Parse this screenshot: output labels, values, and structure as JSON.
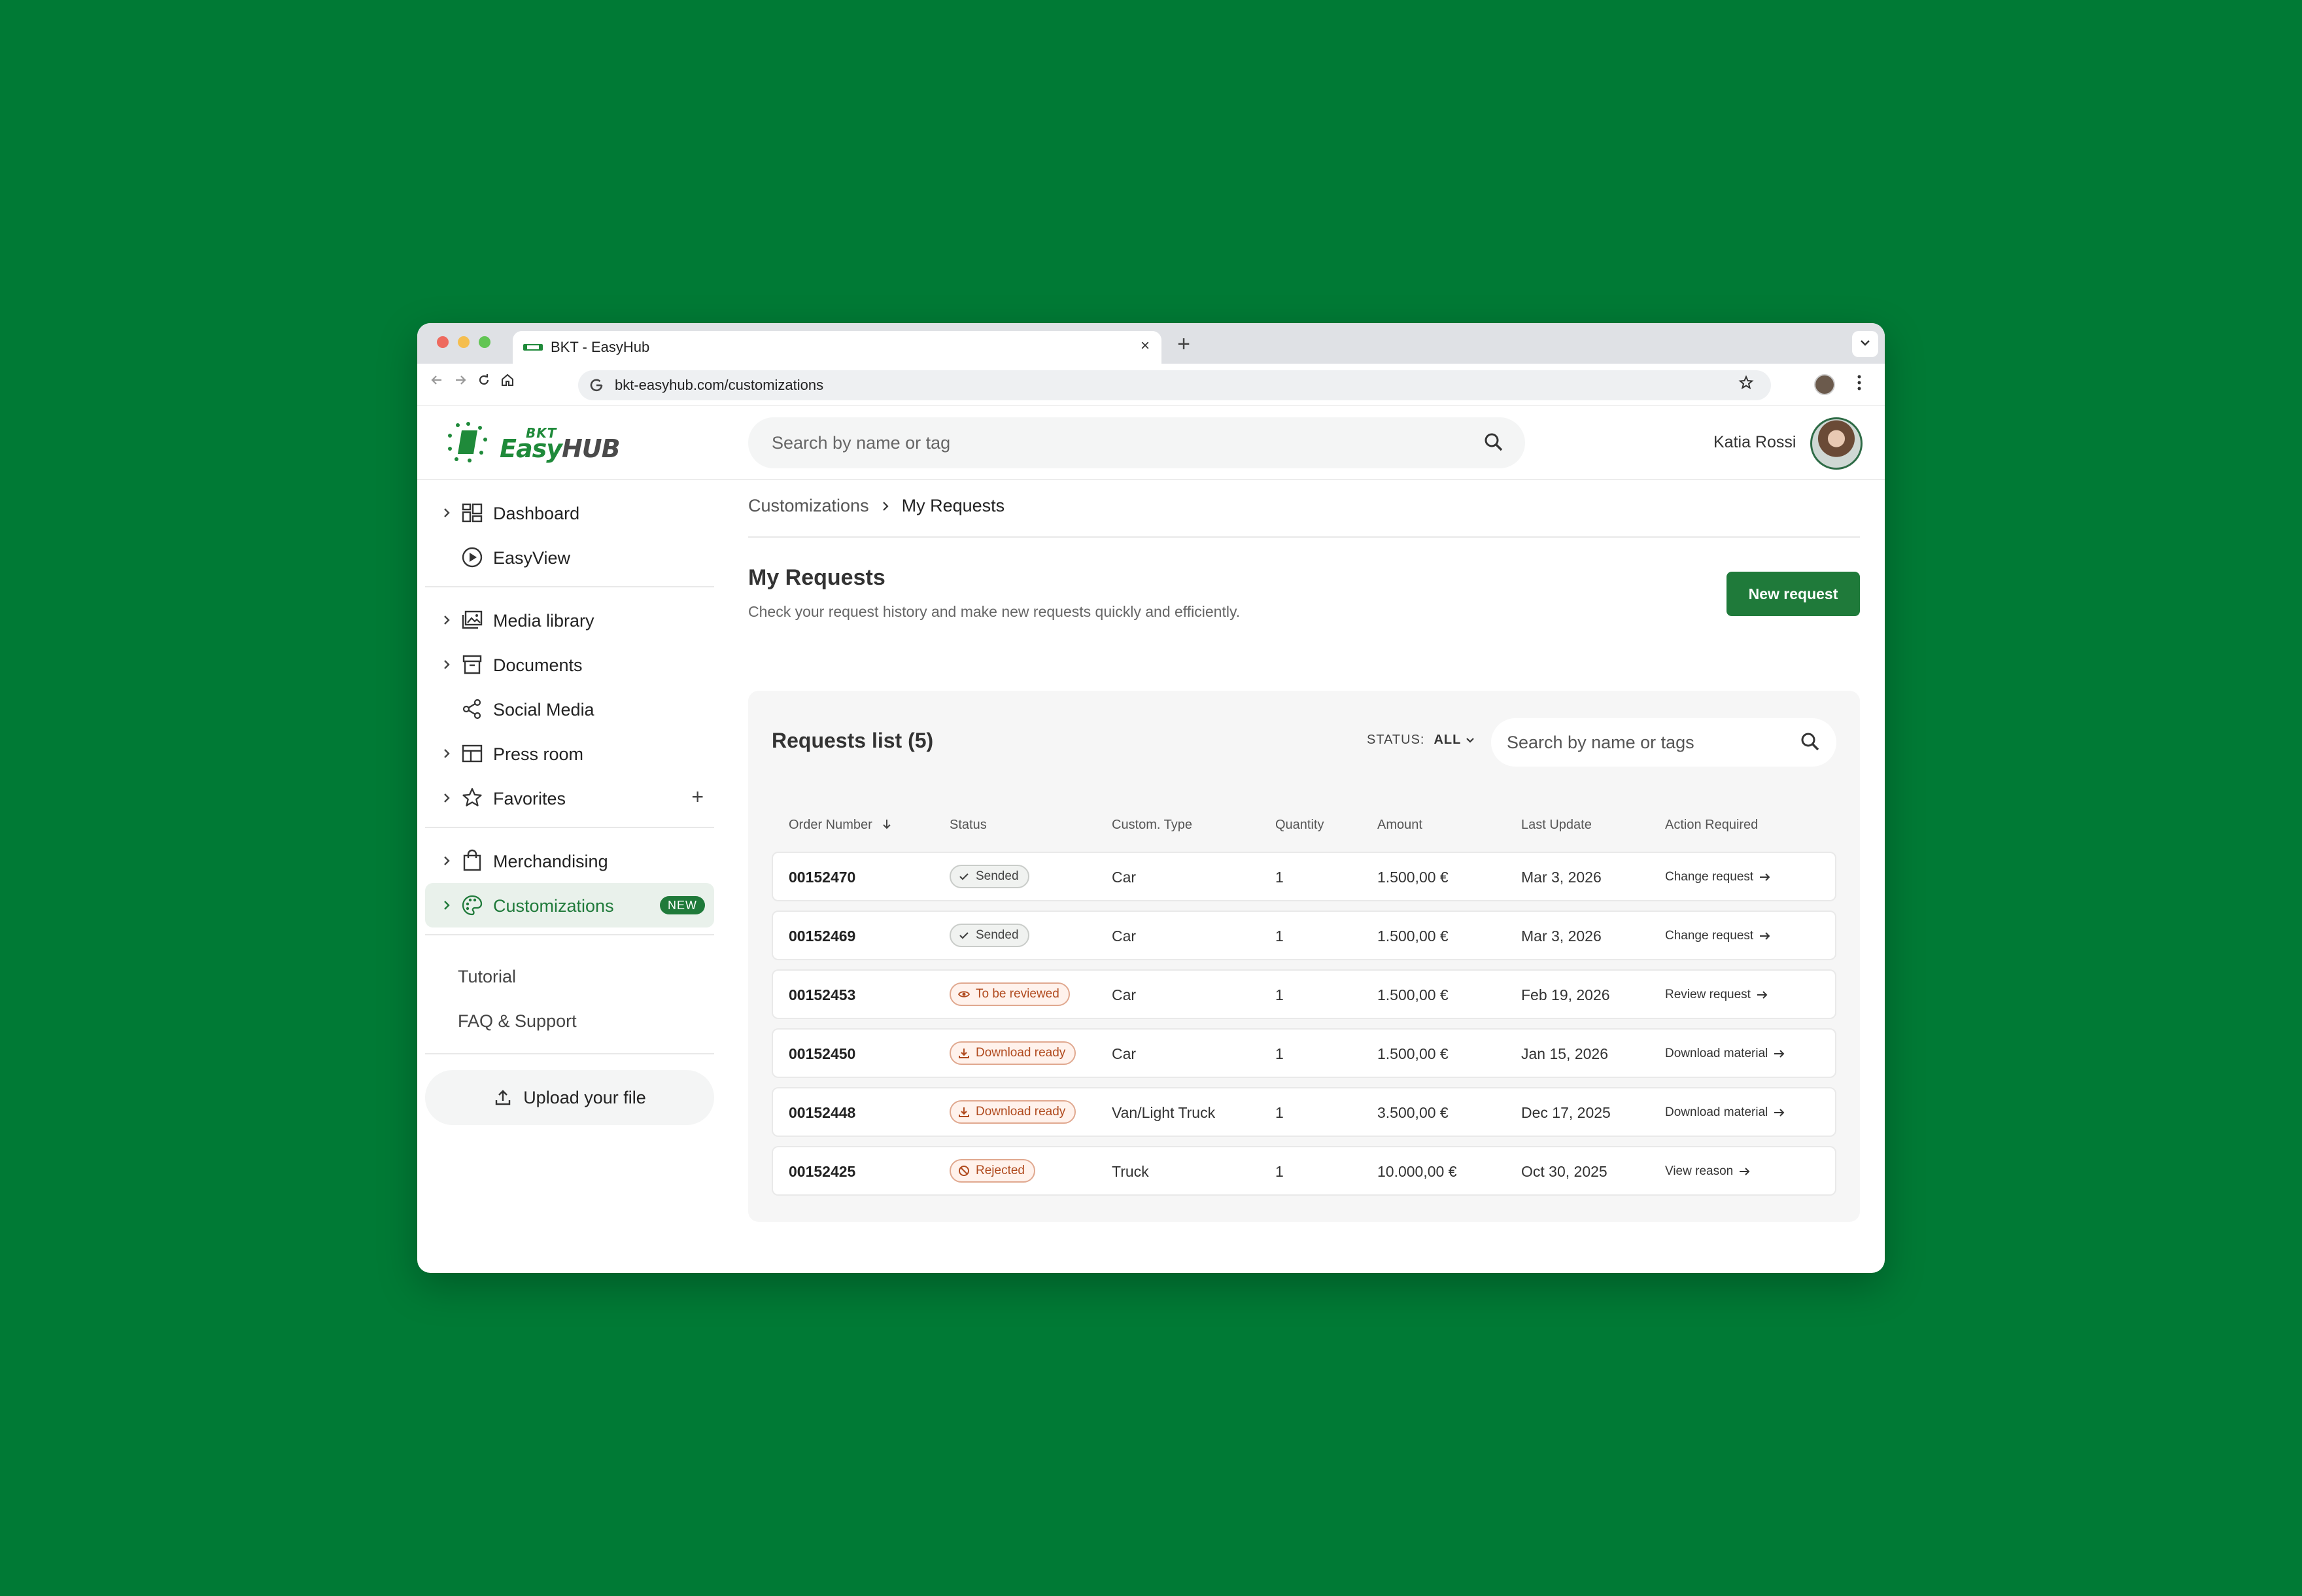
{
  "browser": {
    "tab_title": "BKT - EasyHub",
    "url": "bkt-easyhub.com/customizations"
  },
  "header": {
    "logo_top": "BKT",
    "logo_main_a": "Easy",
    "logo_main_b": "HUB",
    "search_placeholder": "Search by name or tag",
    "user_name": "Katia Rossi"
  },
  "sidebar": {
    "items": [
      {
        "label": "Dashboard",
        "icon": "dashboard-icon"
      },
      {
        "label": "EasyView",
        "icon": "play-circle-icon"
      },
      {
        "label": "Media library",
        "icon": "media-library-icon"
      },
      {
        "label": "Documents",
        "icon": "archive-icon"
      },
      {
        "label": "Social Media",
        "icon": "share-icon"
      },
      {
        "label": "Press room",
        "icon": "layout-icon"
      },
      {
        "label": "Favorites",
        "icon": "star-icon"
      },
      {
        "label": "Merchandising",
        "icon": "shopping-bag-icon"
      },
      {
        "label": "Customizations",
        "icon": "palette-icon",
        "badge": "NEW"
      }
    ],
    "links": [
      "Tutorial",
      "FAQ & Support"
    ],
    "upload_label": "Upload your file"
  },
  "main": {
    "breadcrumb": [
      "Customizations",
      "My Requests"
    ],
    "title": "My Requests",
    "subtitle": "Check your request history and make new requests quickly and efficiently.",
    "new_request_label": "New request",
    "panel": {
      "title": "Requests list (5)",
      "status_label": "STATUS:",
      "status_value": "ALL",
      "search_placeholder": "Search by name or tags",
      "columns": [
        "Order Number",
        "Status",
        "Custom. Type",
        "Quantity",
        "Amount",
        "Last Update",
        "Action Required"
      ],
      "rows": [
        {
          "order": "00152470",
          "status": "Sended",
          "type": "Car",
          "qty": "1",
          "amount": "1.500,00 €",
          "updated": "Mar 3, 2026",
          "action": "Change request"
        },
        {
          "order": "00152469",
          "status": "Sended",
          "type": "Car",
          "qty": "1",
          "amount": "1.500,00 €",
          "updated": "Mar 3, 2026",
          "action": "Change request"
        },
        {
          "order": "00152453",
          "status": "To be reviewed",
          "type": "Car",
          "qty": "1",
          "amount": "1.500,00 €",
          "updated": "Feb 19, 2026",
          "action": "Review request"
        },
        {
          "order": "00152450",
          "status": "Download ready",
          "type": "Car",
          "qty": "1",
          "amount": "1.500,00 €",
          "updated": "Jan 15, 2026",
          "action": "Download material"
        },
        {
          "order": "00152448",
          "status": "Download ready",
          "type": "Van/Light Truck",
          "qty": "1",
          "amount": "3.500,00 €",
          "updated": "Dec 17, 2025",
          "action": "Download material"
        },
        {
          "order": "00152425",
          "status": "Rejected",
          "type": "Truck",
          "qty": "1",
          "amount": "10.000,00 €",
          "updated": "Oct 30, 2025",
          "action": "View reason"
        }
      ]
    }
  },
  "colors": {
    "background": "#007a35",
    "brand": "#1f7a3a",
    "status_warning_text": "#b04a1e"
  }
}
